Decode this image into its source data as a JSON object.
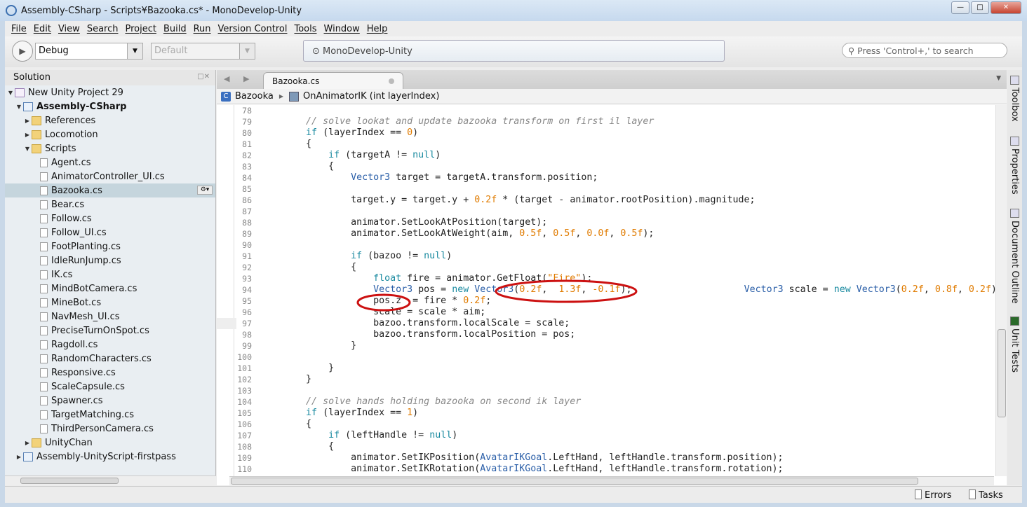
{
  "window": {
    "title": "Assembly-CSharp - Scripts¥Bazooka.cs* - MonoDevelop-Unity",
    "minimize": "—",
    "maximize": "□",
    "close": "✕"
  },
  "menu": [
    "File",
    "Edit",
    "View",
    "Search",
    "Project",
    "Build",
    "Run",
    "Version Control",
    "Tools",
    "Window",
    "Help"
  ],
  "toolbar": {
    "config": "Debug",
    "platform": "Default",
    "status": "MonoDevelop-Unity",
    "search_placeholder": "Press 'Control+,' to search"
  },
  "solution": {
    "title": "Solution",
    "items": [
      {
        "label": "New Unity Project 29",
        "level": 0,
        "icon": "project",
        "expanded": true
      },
      {
        "label": "Assembly-CSharp",
        "level": 1,
        "icon": "assembly",
        "expanded": true,
        "bold": true
      },
      {
        "label": "References",
        "level": 2,
        "icon": "folder",
        "expanded": false
      },
      {
        "label": "Locomotion",
        "level": 2,
        "icon": "folder",
        "expanded": false
      },
      {
        "label": "Scripts",
        "level": 2,
        "icon": "folder",
        "expanded": true
      },
      {
        "label": "Agent.cs",
        "level": 3,
        "icon": "file"
      },
      {
        "label": "AnimatorController_UI.cs",
        "level": 3,
        "icon": "file"
      },
      {
        "label": "Bazooka.cs",
        "level": 3,
        "icon": "file",
        "selected": true
      },
      {
        "label": "Bear.cs",
        "level": 3,
        "icon": "file"
      },
      {
        "label": "Follow.cs",
        "level": 3,
        "icon": "file"
      },
      {
        "label": "Follow_UI.cs",
        "level": 3,
        "icon": "file"
      },
      {
        "label": "FootPlanting.cs",
        "level": 3,
        "icon": "file"
      },
      {
        "label": "IdleRunJump.cs",
        "level": 3,
        "icon": "file"
      },
      {
        "label": "IK.cs",
        "level": 3,
        "icon": "file"
      },
      {
        "label": "MindBotCamera.cs",
        "level": 3,
        "icon": "file"
      },
      {
        "label": "MineBot.cs",
        "level": 3,
        "icon": "file"
      },
      {
        "label": "NavMesh_UI.cs",
        "level": 3,
        "icon": "file"
      },
      {
        "label": "PreciseTurnOnSpot.cs",
        "level": 3,
        "icon": "file"
      },
      {
        "label": "Ragdoll.cs",
        "level": 3,
        "icon": "file"
      },
      {
        "label": "RandomCharacters.cs",
        "level": 3,
        "icon": "file"
      },
      {
        "label": "Responsive.cs",
        "level": 3,
        "icon": "file"
      },
      {
        "label": "ScaleCapsule.cs",
        "level": 3,
        "icon": "file"
      },
      {
        "label": "Spawner.cs",
        "level": 3,
        "icon": "file"
      },
      {
        "label": "TargetMatching.cs",
        "level": 3,
        "icon": "file"
      },
      {
        "label": "ThirdPersonCamera.cs",
        "level": 3,
        "icon": "file"
      },
      {
        "label": "UnityChan",
        "level": 2,
        "icon": "folder",
        "expanded": false
      },
      {
        "label": "Assembly-UnityScript-firstpass",
        "level": 1,
        "icon": "assembly",
        "expanded": false
      }
    ]
  },
  "editor": {
    "tab": "Bazooka.cs",
    "breadcrumb": {
      "class": "Bazooka",
      "method": "OnAnimatorIK (int layerIndex)"
    },
    "current_line": 97,
    "lines": [
      {
        "n": "78",
        "t": []
      },
      {
        "n": "79",
        "t": [
          [
            "",
            "        "
          ],
          [
            "cm",
            "// solve lookat and update bazooka transform on first il layer"
          ]
        ]
      },
      {
        "n": "80",
        "t": [
          [
            "",
            "        "
          ],
          [
            "kw",
            "if"
          ],
          [
            "",
            " (layerIndex == "
          ],
          [
            "nm",
            "0"
          ],
          [
            "",
            ")"
          ]
        ]
      },
      {
        "n": "81",
        "t": [
          [
            "",
            "        {"
          ]
        ]
      },
      {
        "n": "82",
        "t": [
          [
            "",
            "            "
          ],
          [
            "kw",
            "if"
          ],
          [
            "",
            " (targetA != "
          ],
          [
            "kw",
            "null"
          ],
          [
            "",
            ")"
          ]
        ]
      },
      {
        "n": "83",
        "t": [
          [
            "",
            "            {"
          ]
        ]
      },
      {
        "n": "84",
        "t": [
          [
            "",
            "                "
          ],
          [
            "ty",
            "Vector3"
          ],
          [
            "",
            " target = targetA.transform.position;"
          ]
        ]
      },
      {
        "n": "85",
        "t": []
      },
      {
        "n": "86",
        "t": [
          [
            "",
            "                target.y = target.y + "
          ],
          [
            "nm",
            "0.2f"
          ],
          [
            "",
            " * (target - animator.rootPosition).magnitude;"
          ]
        ]
      },
      {
        "n": "87",
        "t": []
      },
      {
        "n": "88",
        "t": [
          [
            "",
            "                animator.SetLookAtPosition(target);"
          ]
        ]
      },
      {
        "n": "89",
        "t": [
          [
            "",
            "                animator.SetLookAtWeight(aim, "
          ],
          [
            "nm",
            "0.5f"
          ],
          [
            "",
            ", "
          ],
          [
            "nm",
            "0.5f"
          ],
          [
            "",
            ", "
          ],
          [
            "nm",
            "0.0f"
          ],
          [
            "",
            ", "
          ],
          [
            "nm",
            "0.5f"
          ],
          [
            "",
            ");"
          ]
        ]
      },
      {
        "n": "90",
        "t": []
      },
      {
        "n": "91",
        "t": [
          [
            "",
            "                "
          ],
          [
            "kw",
            "if"
          ],
          [
            "",
            " (bazoo != "
          ],
          [
            "kw",
            "null"
          ],
          [
            "",
            ")"
          ]
        ]
      },
      {
        "n": "92",
        "t": [
          [
            "",
            "                {"
          ]
        ]
      },
      {
        "n": "93",
        "t": [
          [
            "",
            "                    "
          ],
          [
            "kw",
            "float"
          ],
          [
            "",
            " fire = animator.GetFloat("
          ],
          [
            "st",
            "\"Fire\""
          ],
          [
            "",
            ");"
          ]
        ]
      },
      {
        "n": "94",
        "t": [
          [
            "",
            "                    "
          ],
          [
            "ty",
            "Vector3"
          ],
          [
            "",
            " pos = "
          ],
          [
            "kw",
            "new"
          ],
          [
            "",
            " "
          ],
          [
            "ty",
            "Vector3"
          ],
          [
            "",
            "("
          ],
          [
            "nm",
            "0.2f"
          ],
          [
            "",
            ",  "
          ],
          [
            "nm",
            "1.3f"
          ],
          [
            "",
            ", "
          ],
          [
            "nm",
            "-0.1f"
          ],
          [
            "",
            ");                    "
          ],
          [
            "ty",
            "Vector3"
          ],
          [
            "",
            " scale = "
          ],
          [
            "kw",
            "new"
          ],
          [
            "",
            " "
          ],
          [
            "ty",
            "Vector3"
          ],
          [
            "",
            "("
          ],
          [
            "nm",
            "0.2f"
          ],
          [
            "",
            ", "
          ],
          [
            "nm",
            "0.8f"
          ],
          [
            "",
            ", "
          ],
          [
            "nm",
            "0.2f"
          ],
          [
            "",
            ");"
          ]
        ]
      },
      {
        "n": "95",
        "t": [
          [
            "",
            "                    pos.z  = fire * "
          ],
          [
            "nm",
            "0.2f"
          ],
          [
            "",
            ";"
          ]
        ]
      },
      {
        "n": "96",
        "t": [
          [
            "",
            "                    scale = scale * aim;"
          ]
        ]
      },
      {
        "n": "97",
        "t": [
          [
            "",
            "                    bazoo.transform.localScale = scale;"
          ]
        ]
      },
      {
        "n": "98",
        "t": [
          [
            "",
            "                    bazoo.transform.localPosition = pos;"
          ]
        ]
      },
      {
        "n": "99",
        "t": [
          [
            "",
            "                }"
          ]
        ]
      },
      {
        "n": "100",
        "t": []
      },
      {
        "n": "101",
        "t": [
          [
            "",
            "            }"
          ]
        ]
      },
      {
        "n": "102",
        "t": [
          [
            "",
            "        }"
          ]
        ]
      },
      {
        "n": "103",
        "t": []
      },
      {
        "n": "104",
        "t": [
          [
            "",
            "        "
          ],
          [
            "cm",
            "// solve hands holding bazooka on second ik layer"
          ]
        ]
      },
      {
        "n": "105",
        "t": [
          [
            "",
            "        "
          ],
          [
            "kw",
            "if"
          ],
          [
            "",
            " (layerIndex == "
          ],
          [
            "nm",
            "1"
          ],
          [
            "",
            ")"
          ]
        ]
      },
      {
        "n": "106",
        "t": [
          [
            "",
            "        {"
          ]
        ]
      },
      {
        "n": "107",
        "t": [
          [
            "",
            "            "
          ],
          [
            "kw",
            "if"
          ],
          [
            "",
            " (leftHandle != "
          ],
          [
            "kw",
            "null"
          ],
          [
            "",
            ")"
          ]
        ]
      },
      {
        "n": "108",
        "t": [
          [
            "",
            "            {"
          ]
        ]
      },
      {
        "n": "109",
        "t": [
          [
            "",
            "                animator.SetIKPosition("
          ],
          [
            "ty",
            "AvatarIKGoal"
          ],
          [
            "",
            ".LeftHand, leftHandle.transform.position);"
          ]
        ]
      },
      {
        "n": "110",
        "t": [
          [
            "",
            "                animator.SetIKRotation("
          ],
          [
            "ty",
            "AvatarIKGoal"
          ],
          [
            "",
            ".LeftHand, leftHandle.transform.rotation);"
          ]
        ]
      }
    ]
  },
  "right_pads": [
    "Toolbox",
    "Properties",
    "Document Outline",
    "Unit Tests"
  ],
  "statusbar": {
    "errors": "Errors",
    "tasks": "Tasks"
  },
  "colors": {
    "annotation": "#cc1111",
    "selection": "#c5d5dd"
  }
}
